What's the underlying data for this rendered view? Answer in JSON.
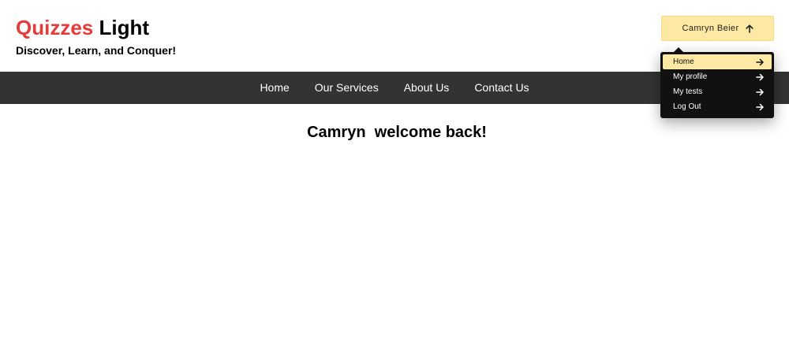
{
  "brand": {
    "accent": "Quizzes",
    "rest": "Light",
    "tagline": "Discover, Learn, and Conquer!",
    "accent_color": "#e63b3b"
  },
  "user_menu": {
    "button_label": "Camryn Beier",
    "button_icon": "arrow-up-icon",
    "button_color": "#fde9a3",
    "items": [
      {
        "label": "Home",
        "icon": "arrow-right-icon",
        "active": true
      },
      {
        "label": "My profile",
        "icon": "arrow-right-icon",
        "active": false
      },
      {
        "label": "My tests",
        "icon": "arrow-right-icon",
        "active": false
      },
      {
        "label": "Log Out",
        "icon": "arrow-right-icon",
        "active": false
      }
    ]
  },
  "nav": {
    "items": [
      {
        "label": "Home"
      },
      {
        "label": "Our Services"
      },
      {
        "label": "About Us"
      },
      {
        "label": "Contact Us"
      }
    ],
    "background": "#333333"
  },
  "main": {
    "welcome": "Camryn  welcome back!"
  }
}
